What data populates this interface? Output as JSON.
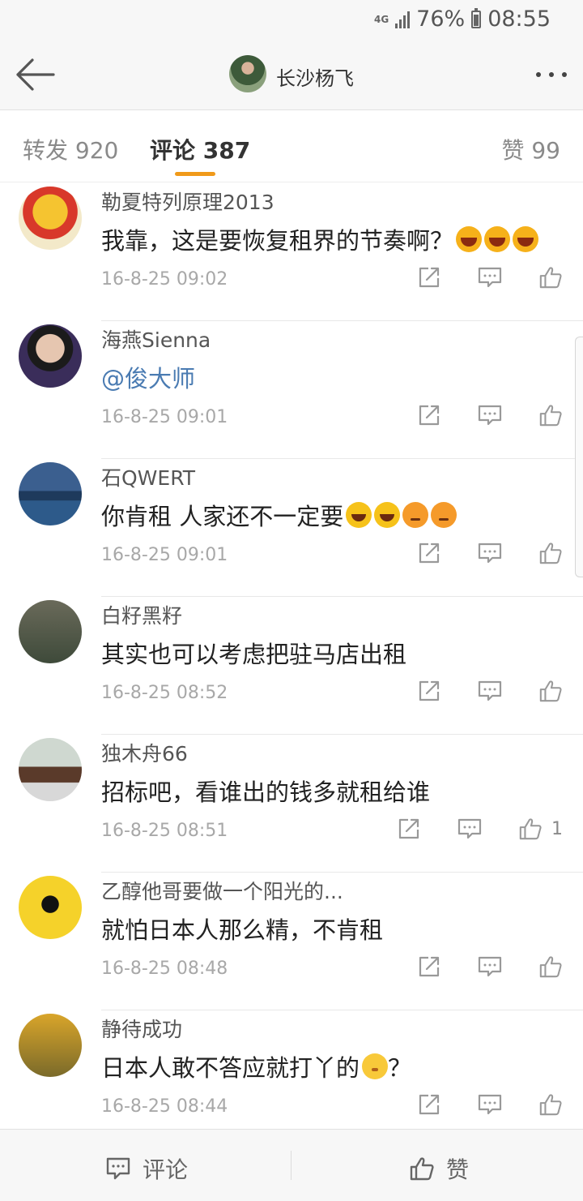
{
  "status": {
    "network": "4G",
    "battery": "76%",
    "time": "08:55"
  },
  "nav": {
    "title": "长沙杨飞"
  },
  "tabs": [
    {
      "label": "转发 920"
    },
    {
      "label": "评论 387"
    },
    {
      "label": "赞 99"
    }
  ],
  "colors": {
    "accent": "#f09a1a",
    "mention": "#4a7bb2"
  },
  "comments": [
    {
      "name": "勒夏特列原理2013",
      "text": "我靠，这是要恢复租界的节奏啊？",
      "emoji": [
        "laugh",
        "laugh",
        "laugh"
      ],
      "time": "16-8-25 09:02",
      "likes": ""
    },
    {
      "name": "海燕Sienna",
      "text": "",
      "mention": "@俊大师",
      "emoji": [],
      "time": "16-8-25 09:01",
      "likes": ""
    },
    {
      "name": "石QWERT",
      "text": "你肯租 人家还不一定要",
      "emoji": [
        "tears",
        "tears",
        "sad",
        "sad"
      ],
      "time": "16-8-25 09:01",
      "likes": ""
    },
    {
      "name": "白籽黑籽",
      "text": "其实也可以考虑把驻马店出租",
      "emoji": [],
      "time": "16-8-25 08:52",
      "likes": ""
    },
    {
      "name": "独木舟66",
      "text": "招标吧，看谁出的钱多就租给谁",
      "emoji": [],
      "time": "16-8-25 08:51",
      "likes": "1"
    },
    {
      "name": "乙醇他哥要做一个阳光的...",
      "text": "就怕日本人那么精，不肯租",
      "emoji": [],
      "time": "16-8-25 08:48",
      "likes": ""
    },
    {
      "name": "静待成功",
      "text": "日本人敢不答应就打丫的",
      "text_after": "？",
      "emoji": [
        "shy"
      ],
      "time": "16-8-25 08:44",
      "likes": ""
    }
  ],
  "bottom": {
    "comment_label": "评论",
    "like_label": "赞"
  }
}
